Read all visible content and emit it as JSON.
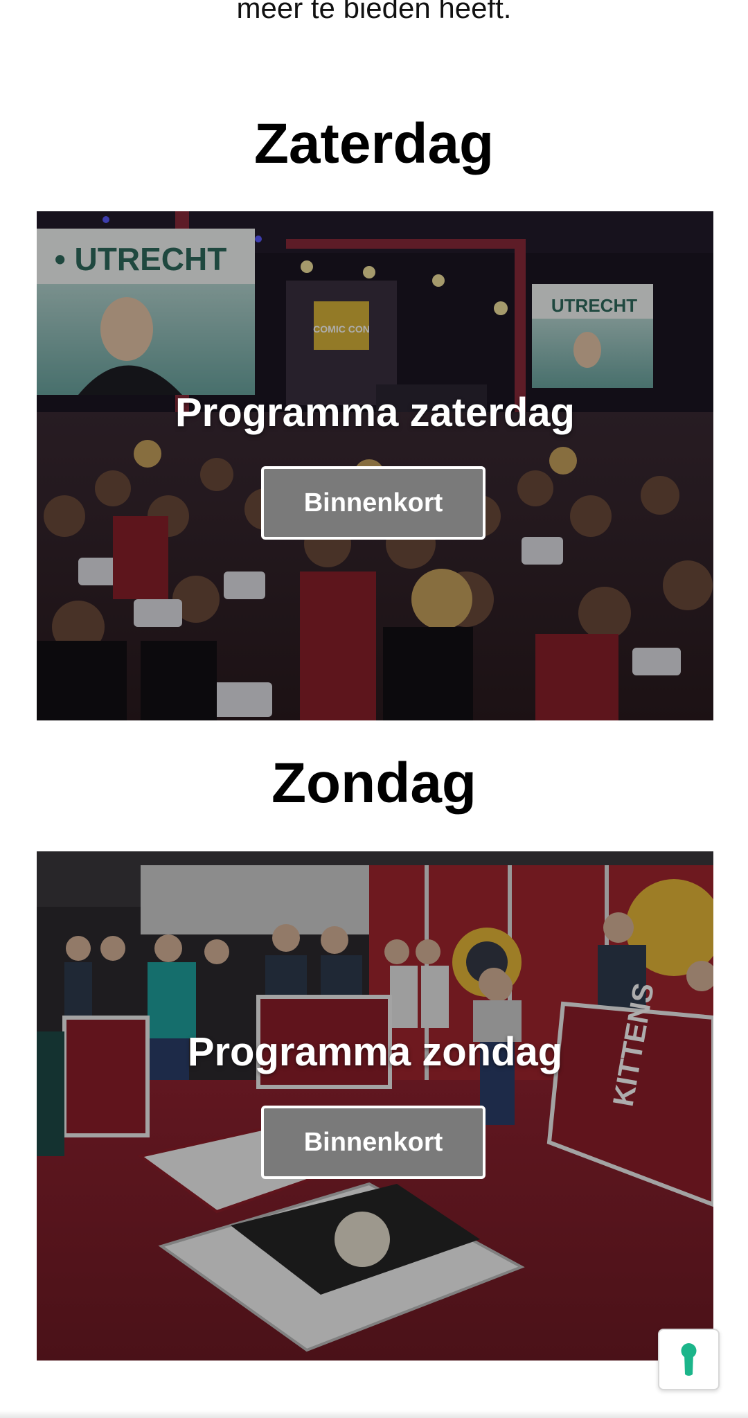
{
  "intro": {
    "text": "meer te bieden heeft."
  },
  "sections": {
    "saturday": {
      "heading": "Zaterdag",
      "card_title": "Programma zaterdag",
      "button_label": "Binnenkort"
    },
    "sunday": {
      "heading": "Zondag",
      "card_title": "Programma zondag",
      "button_label": "Binnenkort"
    }
  },
  "accessibility_widget": {
    "icon": "keyhole-icon",
    "accent_color": "#1bb58a"
  },
  "colors": {
    "button_background": "#7a7a7a",
    "button_border": "#ffffff"
  }
}
